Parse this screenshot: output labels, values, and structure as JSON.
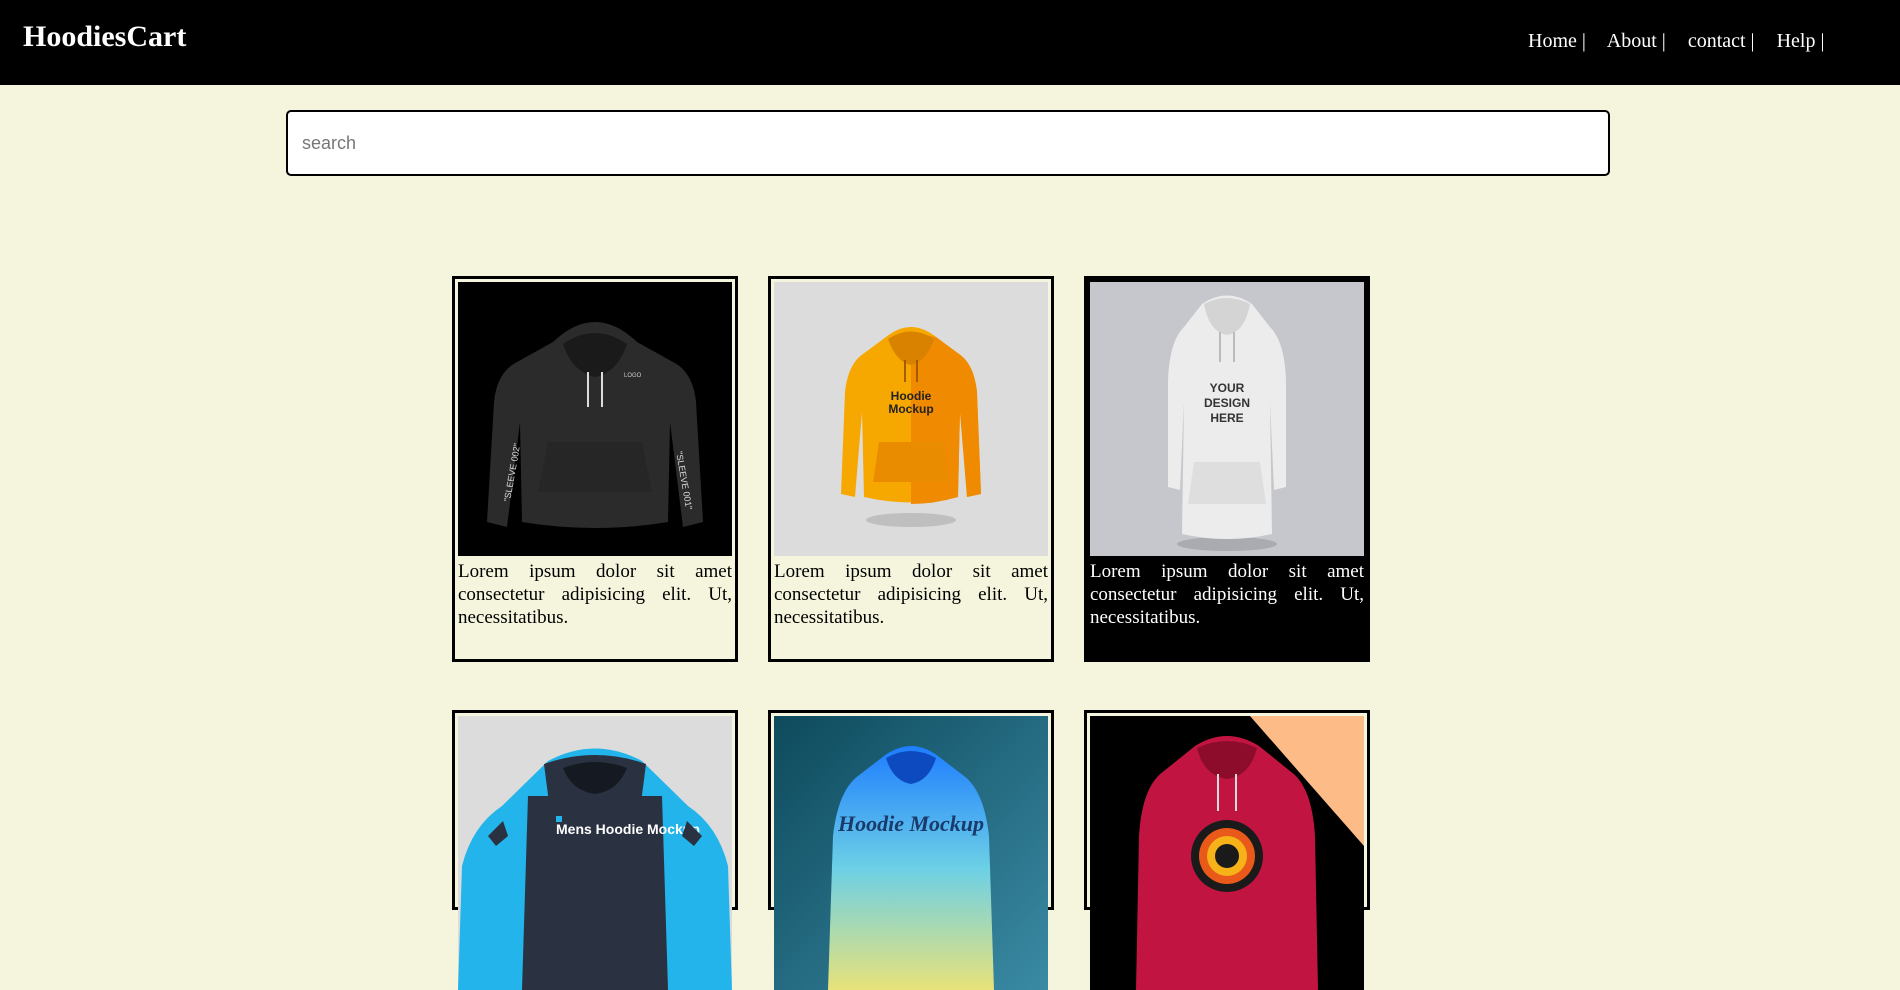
{
  "header": {
    "brand": "HoodiesCart",
    "links": [
      "Home |",
      "About |",
      "contact |",
      "Help |"
    ]
  },
  "search": {
    "placeholder": "search",
    "value": ""
  },
  "products": [
    {
      "image_icon": "black-hoodie-image",
      "description": "Lorem ipsum dolor sit amet consectetur adipisicing elit. Ut, necessitatibus."
    },
    {
      "image_icon": "orange-hoodie-image",
      "description": "Lorem ipsum dolor sit amet consectetur adipisicing elit. Ut, necessitatibus."
    },
    {
      "image_icon": "white-hoodie-image",
      "description": "Lorem ipsum dolor sit amet consectetur adipisicing elit. Ut, necessitatibus."
    },
    {
      "image_icon": "blue-black-hoodie-image",
      "image_text": "Mens Hoodie Mockup"
    },
    {
      "image_icon": "gradient-hoodie-image",
      "image_text": "Hoodie Mockup"
    },
    {
      "image_icon": "red-hoodie-image"
    }
  ],
  "colors": {
    "background": "#f5f4dc",
    "header": "#000000",
    "accent": "#ffffff"
  }
}
